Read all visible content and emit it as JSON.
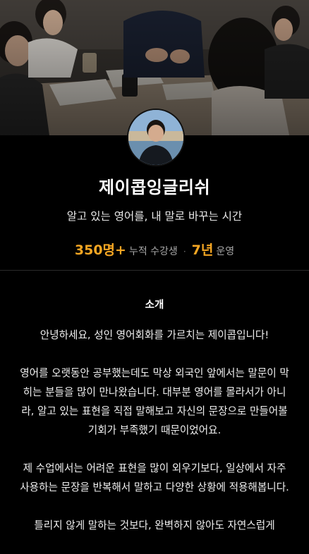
{
  "profile": {
    "name": "제이콥잉글리쉬",
    "tagline": "알고 있는 영어를, 내 말로 바꾸는 시간"
  },
  "stats": {
    "students_value": "350명+",
    "students_label": "누적 수강생",
    "separator": "·",
    "years_value": "7년",
    "years_label": "운영"
  },
  "intro": {
    "heading": "소개",
    "paragraphs": [
      "안녕하세요, 성인 영어회화를 가르치는 제이콥입니다!",
      "영어를 오랫동안 공부했는데도 막상 외국인 앞에서는 말문이 막히는 분들을 많이 만나왔습니다. 대부분 영어를 몰라서가 아니라, 알고 있는 표현을 직접 말해보고 자신의 문장으로 만들어볼 기회가 부족했기 때문이었어요.",
      "제 수업에서는 어려운 표현을 많이 외우기보다, 일상에서 자주 사용하는 문장을 반복해서 말하고 다양한 상황에 적용해봅니다.",
      "틀리지 않게 말하는 것보다, 완벽하지 않아도 자연스럽게"
    ]
  },
  "colors": {
    "background": "#000000",
    "accent": "#f5a623",
    "muted_text": "#a8a8a8"
  }
}
